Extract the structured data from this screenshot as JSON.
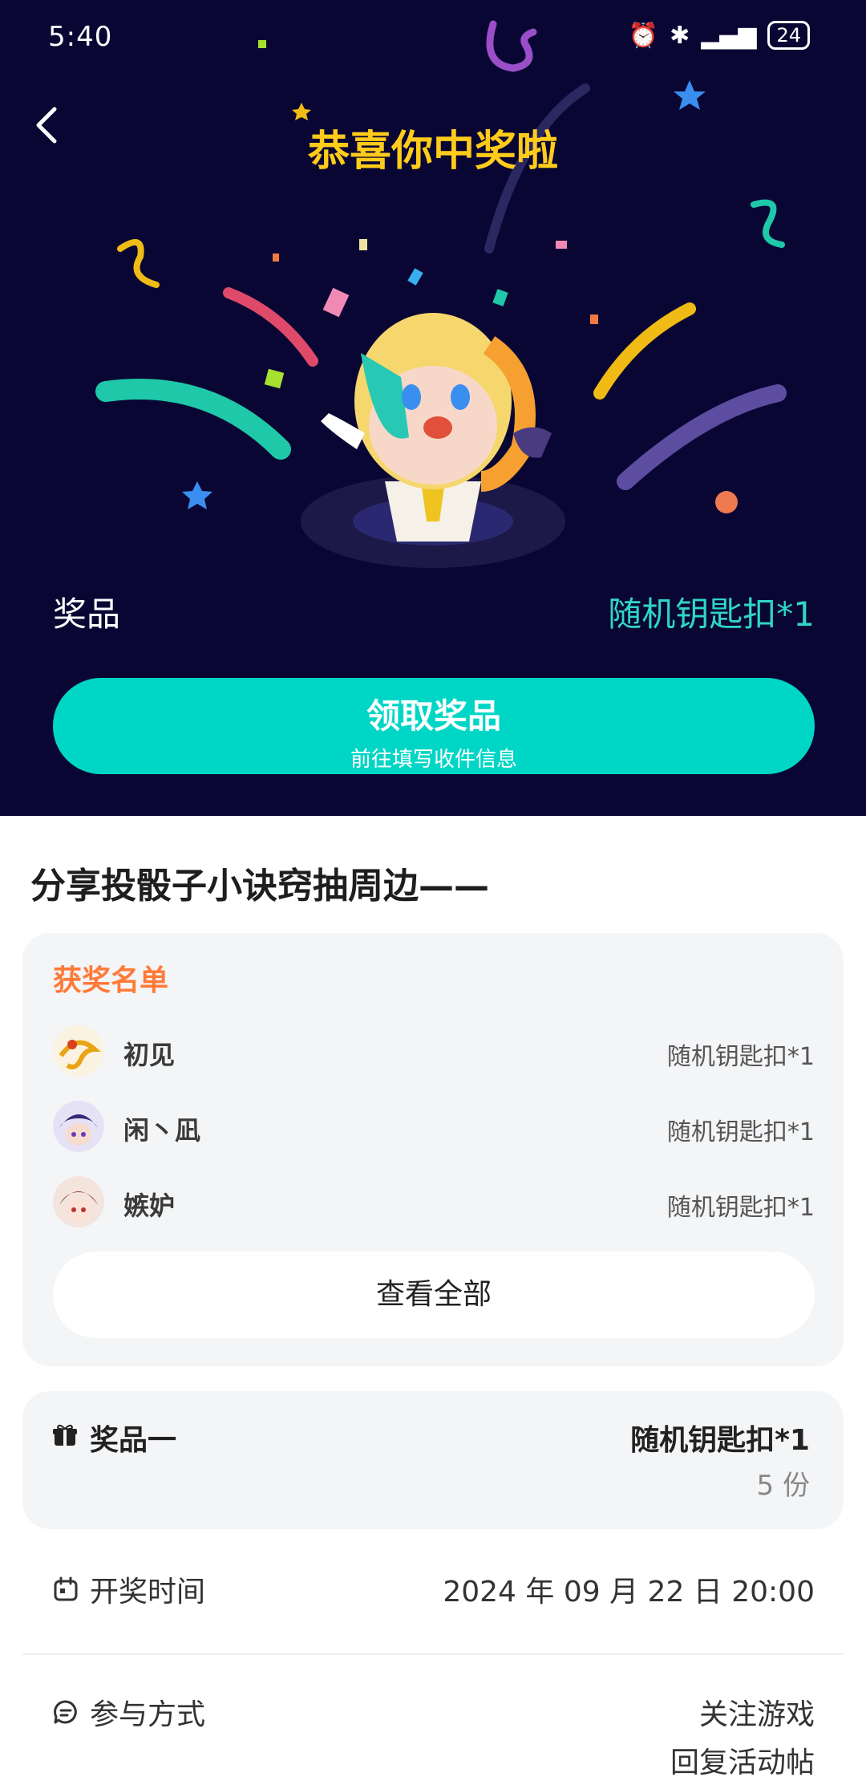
{
  "status_bar": {
    "time": "5:40",
    "battery": "24"
  },
  "hero": {
    "title": "恭喜你中奖啦",
    "prize_label": "奖品",
    "prize_value": "随机钥匙扣*1",
    "claim_button": {
      "label": "领取奖品",
      "sublabel": "前往填写收件信息"
    }
  },
  "event": {
    "title": "分享投骰子小诀窍抽周边——"
  },
  "winners": {
    "heading": "获奖名单",
    "list": [
      {
        "name": "初见",
        "prize": "随机钥匙扣*1"
      },
      {
        "name": "闲丶凪",
        "prize": "随机钥匙扣*1"
      },
      {
        "name": "嫉妒",
        "prize": "随机钥匙扣*1"
      }
    ],
    "view_all": "查看全部"
  },
  "prize_card": {
    "label": "奖品一",
    "value": "随机钥匙扣*1",
    "count": "5 份"
  },
  "draw_time": {
    "label": "开奖时间",
    "value": "2024 年 09 月 22 日 20:00"
  },
  "participation": {
    "label": "参与方式",
    "value_1": "关注游戏",
    "value_2": "回复活动帖"
  },
  "colors": {
    "hero_bg": "#0a0634",
    "accent_teal": "#00d6c6",
    "title_gold": "#ffcc1a",
    "winners_orange": "#ff7a38"
  }
}
